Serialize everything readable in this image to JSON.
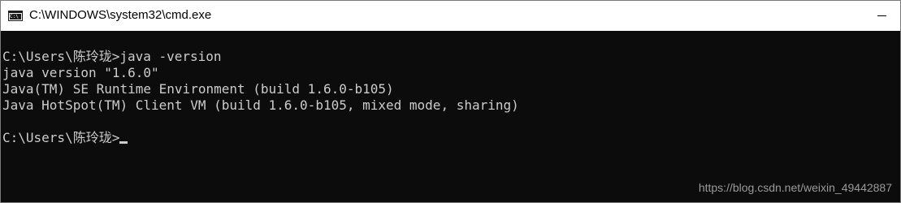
{
  "window": {
    "title": "C:\\WINDOWS\\system32\\cmd.exe",
    "icon": "cmd-icon"
  },
  "console": {
    "lines": [
      "C:\\Users\\陈玲珑>java -version",
      "java version \"1.6.0\"",
      "Java(TM) SE Runtime Environment (build 1.6.0-b105)",
      "Java HotSpot(TM) Client VM (build 1.6.0-b105, mixed mode, sharing)",
      "",
      "C:\\Users\\陈玲珑>"
    ],
    "text_color": "#cccccc",
    "background_color": "#0c0c0c"
  },
  "watermark": "https://blog.csdn.net/weixin_49442887"
}
